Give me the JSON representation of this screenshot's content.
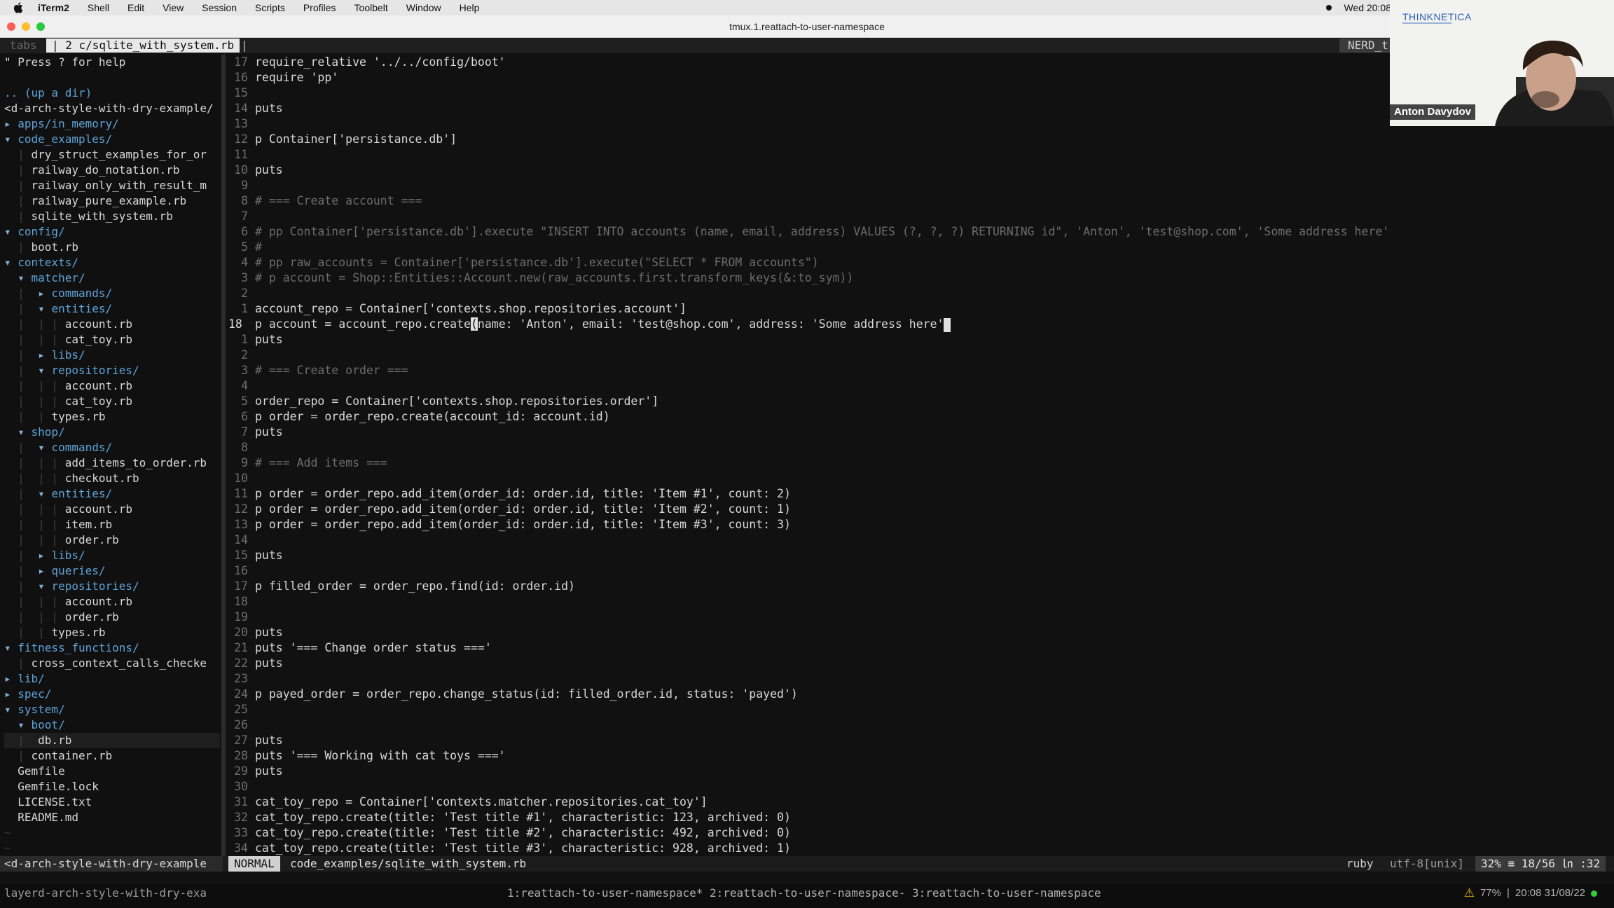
{
  "menubar": {
    "items": [
      "iTerm2",
      "Shell",
      "Edit",
      "View",
      "Session",
      "Scripts",
      "Profiles",
      "Toolbelt",
      "Window",
      "Help"
    ],
    "clock": "Wed 20:08"
  },
  "window": {
    "title": "tmux.1.reattach-to-user-namespace"
  },
  "tabline": {
    "tabs_label": "tabs",
    "active_tab": "| 2 c/sqlite_with_system.rb",
    "separator": "|",
    "right_label": "NERD_t"
  },
  "nerdtree": {
    "lines": [
      {
        "guides": "",
        "arrow": "",
        "name": "\" Press ? for help",
        "type": "help"
      },
      {
        "guides": "",
        "arrow": "",
        "name": "",
        "type": "blank"
      },
      {
        "guides": "",
        "arrow": "",
        "name": ".. (up a dir)",
        "type": "up"
      },
      {
        "guides": "",
        "arrow": "",
        "name": "<d-arch-style-with-dry-example/",
        "type": "root"
      },
      {
        "guides": "",
        "arrow": "▸ ",
        "name": "apps/in_memory/",
        "type": "dir"
      },
      {
        "guides": "",
        "arrow": "▾ ",
        "name": "code_examples/",
        "type": "dir"
      },
      {
        "guides": "  | ",
        "arrow": "",
        "name": "dry_struct_examples_for_or",
        "type": "file"
      },
      {
        "guides": "  | ",
        "arrow": "",
        "name": "railway_do_notation.rb",
        "type": "file"
      },
      {
        "guides": "  | ",
        "arrow": "",
        "name": "railway_only_with_result_m",
        "type": "file"
      },
      {
        "guides": "  | ",
        "arrow": "",
        "name": "railway_pure_example.rb",
        "type": "file"
      },
      {
        "guides": "  | ",
        "arrow": "",
        "name": "sqlite_with_system.rb",
        "type": "file"
      },
      {
        "guides": "",
        "arrow": "▾ ",
        "name": "config/",
        "type": "dir"
      },
      {
        "guides": "  | ",
        "arrow": "",
        "name": "boot.rb",
        "type": "file"
      },
      {
        "guides": "",
        "arrow": "▾ ",
        "name": "contexts/",
        "type": "dir"
      },
      {
        "guides": "  ",
        "arrow": "▾ ",
        "name": "matcher/",
        "type": "dir"
      },
      {
        "guides": "  |  ",
        "arrow": "▸ ",
        "name": "commands/",
        "type": "dir"
      },
      {
        "guides": "  |  ",
        "arrow": "▾ ",
        "name": "entities/",
        "type": "dir"
      },
      {
        "guides": "  |  | | ",
        "arrow": "",
        "name": "account.rb",
        "type": "file"
      },
      {
        "guides": "  |  | | ",
        "arrow": "",
        "name": "cat_toy.rb",
        "type": "file"
      },
      {
        "guides": "  |  ",
        "arrow": "▸ ",
        "name": "libs/",
        "type": "dir"
      },
      {
        "guides": "  |  ",
        "arrow": "▾ ",
        "name": "repositories/",
        "type": "dir"
      },
      {
        "guides": "  |  | | ",
        "arrow": "",
        "name": "account.rb",
        "type": "file"
      },
      {
        "guides": "  |  | | ",
        "arrow": "",
        "name": "cat_toy.rb",
        "type": "file"
      },
      {
        "guides": "  |  | ",
        "arrow": "",
        "name": "types.rb",
        "type": "file"
      },
      {
        "guides": "  ",
        "arrow": "▾ ",
        "name": "shop/",
        "type": "dir"
      },
      {
        "guides": "  |  ",
        "arrow": "▾ ",
        "name": "commands/",
        "type": "dir"
      },
      {
        "guides": "  |  | | ",
        "arrow": "",
        "name": "add_items_to_order.rb",
        "type": "file"
      },
      {
        "guides": "  |  | | ",
        "arrow": "",
        "name": "checkout.rb",
        "type": "file"
      },
      {
        "guides": "  |  ",
        "arrow": "▾ ",
        "name": "entities/",
        "type": "dir"
      },
      {
        "guides": "  |  | | ",
        "arrow": "",
        "name": "account.rb",
        "type": "file"
      },
      {
        "guides": "  |  | | ",
        "arrow": "",
        "name": "item.rb",
        "type": "file"
      },
      {
        "guides": "  |  | | ",
        "arrow": "",
        "name": "order.rb",
        "type": "file"
      },
      {
        "guides": "  |  ",
        "arrow": "▸ ",
        "name": "libs/",
        "type": "dir"
      },
      {
        "guides": "  |  ",
        "arrow": "▸ ",
        "name": "queries/",
        "type": "dir"
      },
      {
        "guides": "  |  ",
        "arrow": "▾ ",
        "name": "repositories/",
        "type": "dir"
      },
      {
        "guides": "  |  | | ",
        "arrow": "",
        "name": "account.rb",
        "type": "file"
      },
      {
        "guides": "  |  | | ",
        "arrow": "",
        "name": "order.rb",
        "type": "file"
      },
      {
        "guides": "  |  | ",
        "arrow": "",
        "name": "types.rb",
        "type": "file"
      },
      {
        "guides": "",
        "arrow": "▾ ",
        "name": "fitness_functions/",
        "type": "dir"
      },
      {
        "guides": "  | ",
        "arrow": "",
        "name": "cross_context_calls_checke",
        "type": "file"
      },
      {
        "guides": "",
        "arrow": "▸ ",
        "name": "lib/",
        "type": "dir"
      },
      {
        "guides": "",
        "arrow": "▸ ",
        "name": "spec/",
        "type": "dir"
      },
      {
        "guides": "",
        "arrow": "▾ ",
        "name": "system/",
        "type": "dir"
      },
      {
        "guides": "  ",
        "arrow": "▾ ",
        "name": "boot/",
        "type": "dir"
      },
      {
        "guides": "  |  ",
        "arrow": "",
        "name": "db.rb",
        "type": "file-cursor"
      },
      {
        "guides": "  | ",
        "arrow": "",
        "name": "container.rb",
        "type": "file"
      },
      {
        "guides": "  ",
        "arrow": "",
        "name": "Gemfile",
        "type": "file"
      },
      {
        "guides": "  ",
        "arrow": "",
        "name": "Gemfile.lock",
        "type": "file"
      },
      {
        "guides": "  ",
        "arrow": "",
        "name": "LICENSE.txt",
        "type": "file"
      },
      {
        "guides": "  ",
        "arrow": "",
        "name": "README.md",
        "type": "file"
      },
      {
        "guides": "",
        "arrow": "",
        "name": "~",
        "type": "tilde"
      },
      {
        "guides": "",
        "arrow": "",
        "name": "~",
        "type": "tilde"
      }
    ]
  },
  "editor": {
    "lines": [
      {
        "n": "17",
        "text": "require_relative '../../config/boot'",
        "kind": "code"
      },
      {
        "n": "16",
        "text": "require 'pp'",
        "kind": "code"
      },
      {
        "n": "15",
        "text": "",
        "kind": "code"
      },
      {
        "n": "14",
        "text": "puts",
        "kind": "code"
      },
      {
        "n": "13",
        "text": "",
        "kind": "code"
      },
      {
        "n": "12",
        "text": "p Container['persistance.db']",
        "kind": "code"
      },
      {
        "n": "11",
        "text": "",
        "kind": "code"
      },
      {
        "n": "10",
        "text": "puts",
        "kind": "code"
      },
      {
        "n": "9",
        "text": "",
        "kind": "code"
      },
      {
        "n": "8",
        "text": "# === Create account ===",
        "kind": "comment"
      },
      {
        "n": "7",
        "text": "",
        "kind": "code"
      },
      {
        "n": "6",
        "text": "# pp Container['persistance.db'].execute \"INSERT INTO accounts (name, email, address) VALUES (?, ?, ?) RETURNING id\", 'Anton', 'test@shop.com', 'Some address here'",
        "kind": "comment"
      },
      {
        "n": "5",
        "text": "#",
        "kind": "comment"
      },
      {
        "n": "4",
        "text": "# pp raw_accounts = Container['persistance.db'].execute(\"SELECT * FROM accounts\")",
        "kind": "comment"
      },
      {
        "n": "3",
        "text": "# p account = Shop::Entities::Account.new(raw_accounts.first.transform_keys(&:to_sym))",
        "kind": "comment"
      },
      {
        "n": "2",
        "text": "",
        "kind": "code"
      },
      {
        "n": "1",
        "text": "account_repo = Container['contexts.shop.repositories.account']",
        "kind": "code"
      },
      {
        "n": "18",
        "text_before": "p account = account_repo.create",
        "text_cursor": "(",
        "text_after": "name: 'Anton', email: 'test@shop.com', address: 'Some address here'",
        "kind": "current"
      },
      {
        "n": "1",
        "text": "puts",
        "kind": "code"
      },
      {
        "n": "2",
        "text": "",
        "kind": "code"
      },
      {
        "n": "3",
        "text": "# === Create order ===",
        "kind": "comment"
      },
      {
        "n": "4",
        "text": "",
        "kind": "code"
      },
      {
        "n": "5",
        "text": "order_repo = Container['contexts.shop.repositories.order']",
        "kind": "code"
      },
      {
        "n": "6",
        "text": "p order = order_repo.create(account_id: account.id)",
        "kind": "code"
      },
      {
        "n": "7",
        "text": "puts",
        "kind": "code"
      },
      {
        "n": "8",
        "text": "",
        "kind": "code"
      },
      {
        "n": "9",
        "text": "# === Add items ===",
        "kind": "comment"
      },
      {
        "n": "10",
        "text": "",
        "kind": "code"
      },
      {
        "n": "11",
        "text": "p order = order_repo.add_item(order_id: order.id, title: 'Item #1', count: 2)",
        "kind": "code"
      },
      {
        "n": "12",
        "text": "p order = order_repo.add_item(order_id: order.id, title: 'Item #2', count: 1)",
        "kind": "code"
      },
      {
        "n": "13",
        "text": "p order = order_repo.add_item(order_id: order.id, title: 'Item #3', count: 3)",
        "kind": "code"
      },
      {
        "n": "14",
        "text": "",
        "kind": "code"
      },
      {
        "n": "15",
        "text": "puts",
        "kind": "code"
      },
      {
        "n": "16",
        "text": "",
        "kind": "code"
      },
      {
        "n": "17",
        "text": "p filled_order = order_repo.find(id: order.id)",
        "kind": "code"
      },
      {
        "n": "18",
        "text": "",
        "kind": "code"
      },
      {
        "n": "19",
        "text": "",
        "kind": "code"
      },
      {
        "n": "20",
        "text": "puts",
        "kind": "code"
      },
      {
        "n": "21",
        "text": "puts '=== Change order status ==='",
        "kind": "code"
      },
      {
        "n": "22",
        "text": "puts",
        "kind": "code"
      },
      {
        "n": "23",
        "text": "",
        "kind": "code"
      },
      {
        "n": "24",
        "text": "p payed_order = order_repo.change_status(id: filled_order.id, status: 'payed')",
        "kind": "code"
      },
      {
        "n": "25",
        "text": "",
        "kind": "code"
      },
      {
        "n": "26",
        "text": "",
        "kind": "code"
      },
      {
        "n": "27",
        "text": "puts",
        "kind": "code"
      },
      {
        "n": "28",
        "text": "puts '=== Working with cat toys ==='",
        "kind": "code"
      },
      {
        "n": "29",
        "text": "puts",
        "kind": "code"
      },
      {
        "n": "30",
        "text": "",
        "kind": "code"
      },
      {
        "n": "31",
        "text": "cat_toy_repo = Container['contexts.matcher.repositories.cat_toy']",
        "kind": "code"
      },
      {
        "n": "32",
        "text": "cat_toy_repo.create(title: 'Test title #1', characteristic: 123, archived: 0)",
        "kind": "code"
      },
      {
        "n": "33",
        "text": "cat_toy_repo.create(title: 'Test title #2', characteristic: 492, archived: 0)",
        "kind": "code"
      },
      {
        "n": "34",
        "text": "cat_toy_repo.create(title: 'Test title #3', characteristic: 928, archived: 1)",
        "kind": "code"
      }
    ]
  },
  "statusline": {
    "nerdtree_status": "<d-arch-style-with-dry-example",
    "mode": "NORMAL",
    "file": "code_examples/sqlite_with_system.rb",
    "filetype": "ruby",
    "encoding": "utf-8[unix]",
    "position": "32% ≡ 18/56 ㏑ :32"
  },
  "tmux": {
    "session": "layerd-arch-style-with-dry-exa",
    "windows": "1:reattach-to-user-namespace* 2:reattach-to-user-namespace- 3:reattach-to-user-namespace",
    "battery": "77%",
    "separator": "|",
    "datetime": "20:08 31/08/22"
  },
  "webcam": {
    "brand": "THINKNETICA",
    "name": "Anton Davydov"
  },
  "colors": {
    "close": "#fe5f57",
    "minimize": "#febc2e",
    "zoom": "#28c840",
    "directory": "#5fa3d8",
    "comment": "#6c6c6c"
  }
}
